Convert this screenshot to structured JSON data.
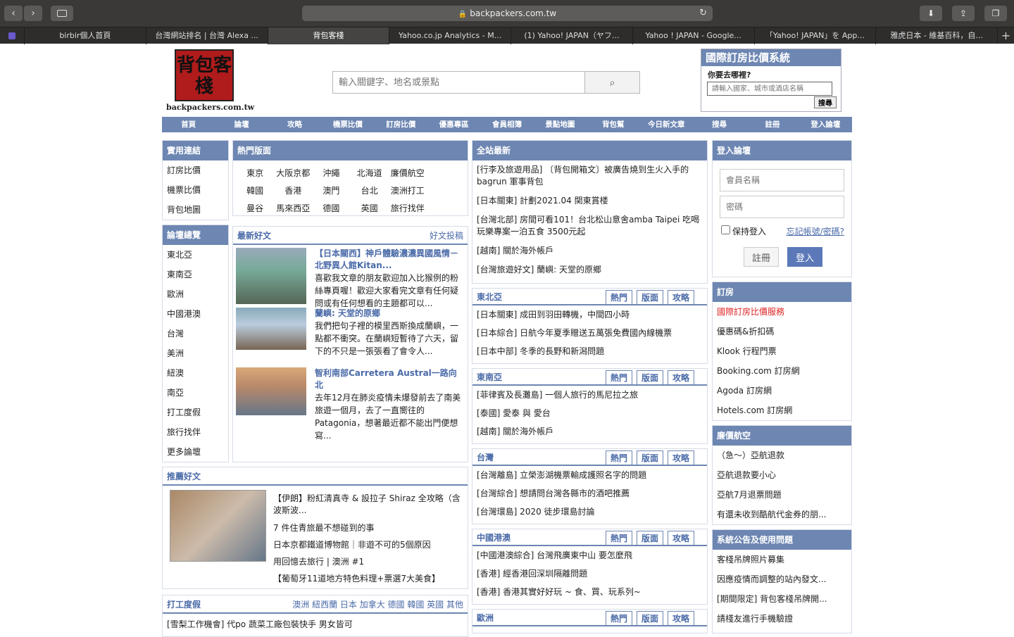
{
  "browser": {
    "url": "backpackers.com.tw",
    "tabs": [
      "birbir個人首頁",
      "台灣網站排名 | 台灣 Alexa ...",
      "背包客棧",
      "Yahoo.co.jp Analytics - M...",
      "(1) Yahoo! JAPAN（ヤフ...",
      "Yahoo ! JAPAN - Google...",
      "「Yahoo! JAPAN」を App...",
      "雅虎日本 - 維基百科，自..."
    ]
  },
  "header": {
    "logo_text": "背包客棧",
    "logo_domain": "backpackers.com.tw",
    "search_placeholder": "輸入關鍵字、地名或景點",
    "hotel_title": "國際訂房比價系統",
    "hotel_q": "你要去哪裡?",
    "hotel_placeholder": "請輸入國家、城市或酒店名稱",
    "hotel_btn": "搜尋"
  },
  "menu": [
    "首頁",
    "論壇",
    "攻略",
    "機票比價",
    "訂房比價",
    "優惠專區",
    "會員相簿",
    "景點地圖",
    "背包幫",
    "今日新文章",
    "搜尋",
    "註冊",
    "登入論壇"
  ],
  "useful": {
    "title": "實用連結",
    "items": [
      "訂房比價",
      "機票比價",
      "背包地圖"
    ]
  },
  "forums": {
    "title": "論壇總覽",
    "items": [
      "東北亞",
      "東南亞",
      "歐洲",
      "中國港澳",
      "台灣",
      "美洲",
      "紐澳",
      "南亞",
      "打工度假",
      "旅行找伴",
      "更多論壇"
    ]
  },
  "hot": {
    "title": "熱門版面",
    "items": [
      "東京",
      "大阪京都",
      "沖繩",
      "北海道",
      "廉價航空",
      "韓國",
      "香港",
      "澳門",
      "台北",
      "澳洲打工",
      "曼谷",
      "馬來西亞",
      "德國",
      "英國",
      "旅行找伴"
    ]
  },
  "latest": {
    "title": "最新好文",
    "link": "好文投稿",
    "articles": [
      {
        "t": "【日本關西】神戶體驗濃濃異國風情－北野異人館Kitan...",
        "d": "喜歡我文章的朋友歡迎加入比猴例的粉絲專頁喔！歡迎大家看完文章有任何疑問或有任何想看的主題都可以..."
      },
      {
        "t": "蘭嶼: 天堂的原鄉",
        "d": "我們把句子裡的模里西斯換成蘭嶼，一點都不衝突。在蘭嶼短暫待了六天，留下的不只是一張張看了會令人..."
      },
      {
        "t": "智利南部Carretera Austral一路向北",
        "d": "去年12月在肺炎疫情未爆發前去了南美旅遊一個月，去了一直嚮往的Patagonia，想著最近都不能出門便想寫..."
      }
    ]
  },
  "recommend": {
    "title": "推薦好文",
    "items": [
      "【伊朗】粉紅清真寺 & 設拉子 Shiraz 全攻略（含波斯波...",
      "7 件住青旅最不想碰到的事",
      "日本京都鐵道博物館｜非遊不可的5個原因",
      "用回憶去旅行 | 澳洲 #1",
      "【葡萄牙11道地方特色料理+票選7大美食】"
    ]
  },
  "working": {
    "title": "打工度假",
    "links": "澳洲 紐西蘭 日本 加拿大 德國 韓國 英國 其他",
    "item": "[雪梨工作機會] 代po 蔬菜工廠包裝快手 男女皆可"
  },
  "sitenews": {
    "title": "全站最新",
    "items": [
      "[行李及旅遊用品] 〔背包開箱文〕被廣告燒到生火入手的bagrun 軍事背包",
      "[日本關東] 計劃2021.04 関東賞楼",
      "[台灣北部] 房間可看101！台北松山意舍amba Taipei 吃喝玩樂專案一泊五食 3500元起",
      "[越南] 關於海外帳戶",
      "[台灣旅遊好文] 蘭嶼: 天堂的原鄉"
    ]
  },
  "tags": [
    "熱門",
    "版面",
    "攻略"
  ],
  "sections": [
    {
      "title": "東北亞",
      "rows": [
        "[日本關東] 成田到羽田轉機，中間四小時",
        "[日本綜合] 日航今年夏季贈送五萬張免費國內線機票",
        "[日本中部] 冬季的長野和新潟問題"
      ]
    },
    {
      "title": "東南亞",
      "rows": [
        "[菲律賓及長灘島] 一個人旅行的馬尼拉之旅",
        "[泰國] 愛泰 與 愛台",
        "[越南] 關於海外帳戶"
      ]
    },
    {
      "title": "台灣",
      "rows": [
        "[台灣離島] 立榮澎湖機票輸成護照名字的問題",
        "[台灣綜合] 想請問台灣各縣市的酒吧推薦",
        "[台灣環島] 2020 徒步環島討論"
      ]
    },
    {
      "title": "中國港澳",
      "rows": [
        "[中國港澳綜合] 台灣飛廣東中山 要怎麼飛",
        "[香港] 經香港回深圳隔離問題",
        "[香港] 香港其實好好玩 ~ 食、買、玩系列~"
      ]
    },
    {
      "title": "歐洲",
      "rows": []
    }
  ],
  "login": {
    "title": "登入論壇",
    "user": "會員名稱",
    "pass": "密碼",
    "keep": "保持登入",
    "forgot": "忘記帳號/密碼?",
    "register": "註冊",
    "submit": "登入"
  },
  "booking": {
    "title": "訂房",
    "items": [
      "國際訂房比價服務",
      "優惠碼&折扣碼",
      "Klook 行程門票",
      "Booking.com 訂房網",
      "Agoda 訂房網",
      "Hotels.com 訂房網"
    ]
  },
  "airline": {
    "title": "廉價航空",
    "items": [
      "（急～）亞航退款",
      "亞航退款要小心",
      "亞航7月退票問題",
      "有還未收到酷航代金券的朋..."
    ]
  },
  "notice": {
    "title": "系統公告及使用問題",
    "items": [
      "客棧吊牌照片募集",
      "因應疫情而調整的站內發文...",
      "[期間限定] 背包客棧吊牌開...",
      "請棧友進行手機驗證"
    ]
  }
}
